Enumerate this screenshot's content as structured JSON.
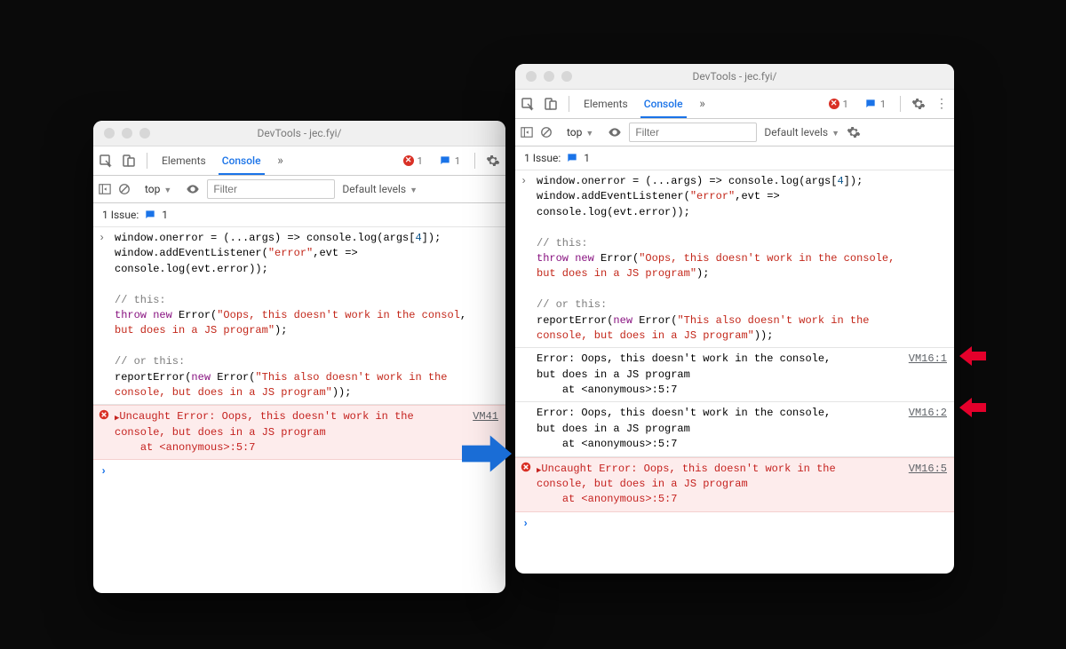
{
  "windows": {
    "left": {
      "title": "DevTools - jec.fyi/",
      "tabs": {
        "elements": "Elements",
        "console": "Console"
      },
      "badges": {
        "errors": "1",
        "messages": "1"
      },
      "toolbar": {
        "context": "top",
        "filter_placeholder": "Filter",
        "levels": "Default levels"
      },
      "issues": {
        "label": "1 Issue:",
        "count": "1"
      },
      "code_html": "window.onerror = (...args) => console.log(args[<span class='num'>4</span>]);\nwindow.addEventListener(<span class='str'>\"error\"</span>,evt =>\nconsole.log(evt.error));\n\n<span class='cm'>// this:</span>\n<span class='kw'>throw new</span> Error(<span class='str'>\"Oops, this doesn't work in the consol</span>,\n<span class='str'>but does in a JS program\"</span>);\n\n<span class='cm'>// or this:</span>\nreportError(<span class='kw'>new</span> Error(<span class='str'>\"This also doesn't work in the\nconsole, but does in a JS program\"</span>));",
      "error": {
        "text": "Uncaught Error: Oops, this doesn't work in the\nconsole, but does in a JS program\n    at <anonymous>:5:7",
        "source": "VM41"
      }
    },
    "right": {
      "title": "DevTools - jec.fyi/",
      "tabs": {
        "elements": "Elements",
        "console": "Console"
      },
      "badges": {
        "errors": "1",
        "messages": "1"
      },
      "toolbar": {
        "context": "top",
        "filter_placeholder": "Filter",
        "levels": "Default levels"
      },
      "issues": {
        "label": "1 Issue:",
        "count": "1"
      },
      "code_html": "window.onerror = (...args) => console.log(args[<span class='num'>4</span>]);\nwindow.addEventListener(<span class='str'>\"error\"</span>,evt =>\nconsole.log(evt.error));\n\n<span class='cm'>// this:</span>\n<span class='kw'>throw new</span> Error(<span class='str'>\"Oops, this doesn't work in the console,\nbut does in a JS program\"</span>);\n\n<span class='cm'>// or this:</span>\nreportError(<span class='kw'>new</span> Error(<span class='str'>\"This also doesn't work in the\nconsole, but does in a JS program\"</span>));",
      "log1": {
        "text": "Error: Oops, this doesn't work in the console,\nbut does in a JS program\n    at <anonymous>:5:7",
        "source": "VM16:1"
      },
      "log2": {
        "text": "Error: Oops, this doesn't work in the console,\nbut does in a JS program\n    at <anonymous>:5:7",
        "source": "VM16:2"
      },
      "error": {
        "text": "Uncaught Error: Oops, this doesn't work in the\nconsole, but does in a JS program\n    at <anonymous>:5:7",
        "source": "VM16:5"
      }
    }
  }
}
